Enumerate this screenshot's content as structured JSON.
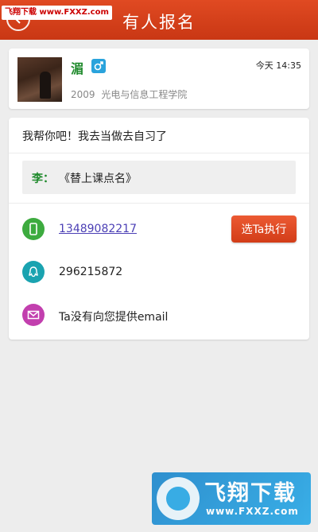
{
  "header": {
    "title": "有人报名",
    "watermark_label": "飞翔下载",
    "watermark_url": "www.FXXZ.com"
  },
  "profile": {
    "nickname": "湄",
    "gender": "male",
    "time": "今天  14:35",
    "school": "2009 光电与信息工程学院"
  },
  "detail": {
    "description": "我帮你吧！我去当做去自习了",
    "task_owner": "李：",
    "task_title": "《替上课点名》",
    "phone": "13489082217",
    "qq": "296215872",
    "email_text": "Ta没有向您提供email",
    "select_button": "选Ta执行"
  },
  "watermark": {
    "cn_text": "飞翔下载",
    "en_text": "www.FXXZ.com"
  },
  "colors": {
    "header": "#d84120",
    "accent_green": "#1f8a2c",
    "phone_icon": "#3dab3f",
    "qq_icon": "#1aa3b0",
    "email_icon": "#c23fae",
    "button": "#e04a22"
  }
}
